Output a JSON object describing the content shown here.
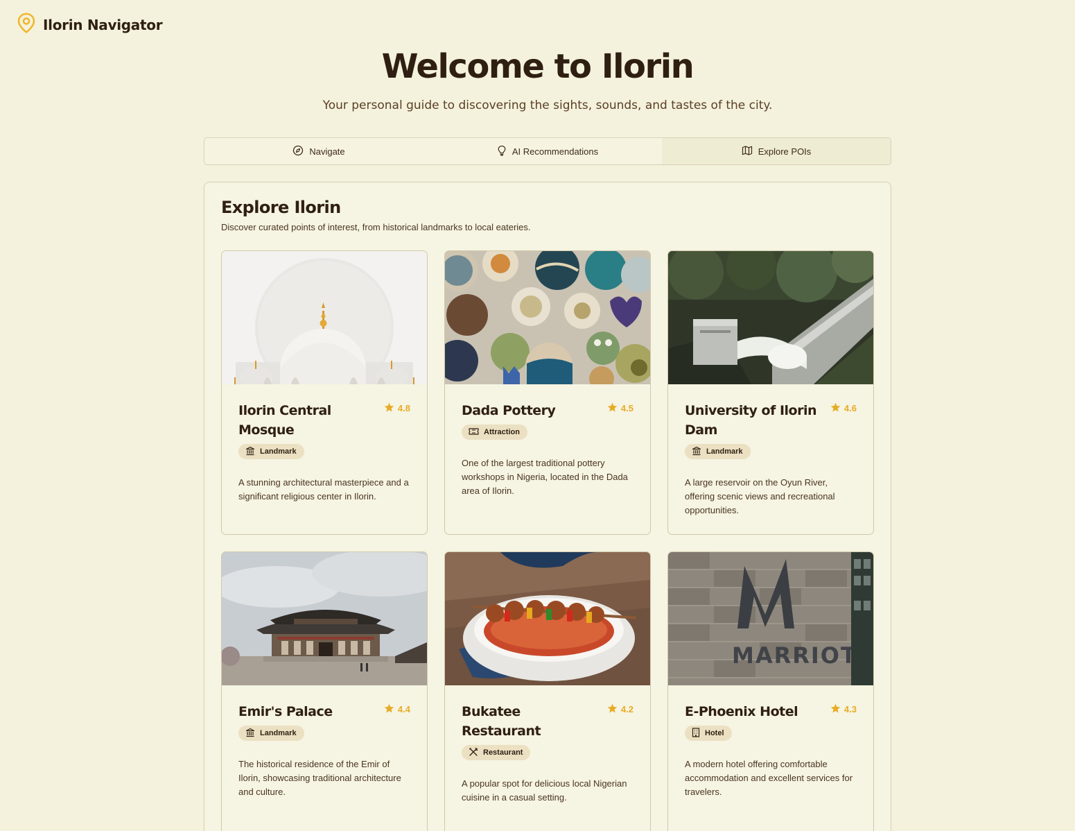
{
  "brand": {
    "title": "Ilorin Navigator",
    "icon": "map-pin-icon",
    "accent": "#f0b72f"
  },
  "hero": {
    "title": "Welcome to Ilorin",
    "subtitle": "Your personal guide to discovering the sights, sounds, and tastes of the city."
  },
  "tabs": [
    {
      "label": "Navigate",
      "icon": "compass-icon",
      "active": false
    },
    {
      "label": "AI Recommendations",
      "icon": "lightbulb-icon",
      "active": false
    },
    {
      "label": "Explore POIs",
      "icon": "map-icon",
      "active": true
    }
  ],
  "explore": {
    "title": "Explore Ilorin",
    "subtitle": "Discover curated points of interest, from historical landmarks to local eateries."
  },
  "pois": [
    {
      "name": "Ilorin Central Mosque",
      "rating": "4.8",
      "category": "Landmark",
      "category_icon": "landmark-icon",
      "description": "A stunning architectural masterpiece and a significant religious center in Ilorin.",
      "image": "mosque-photo"
    },
    {
      "name": "Dada Pottery",
      "rating": "4.5",
      "category": "Attraction",
      "category_icon": "ticket-icon",
      "description": "One of the largest traditional pottery workshops in Nigeria, located in the Dada area of Ilorin.",
      "image": "pottery-photo"
    },
    {
      "name": "University of Ilorin Dam",
      "rating": "4.6",
      "category": "Landmark",
      "category_icon": "landmark-icon",
      "description": "A large reservoir on the Oyun River, offering scenic views and recreational opportunities.",
      "image": "dam-photo"
    },
    {
      "name": "Emir's Palace",
      "rating": "4.4",
      "category": "Landmark",
      "category_icon": "landmark-icon",
      "description": "The historical residence of the Emir of Ilorin, showcasing traditional architecture and culture.",
      "image": "palace-photo"
    },
    {
      "name": "Bukatee Restaurant",
      "rating": "4.2",
      "category": "Restaurant",
      "category_icon": "utensils-icon",
      "description": "A popular spot for delicious local Nigerian cuisine in a casual setting.",
      "image": "food-photo"
    },
    {
      "name": "E-Phoenix Hotel",
      "rating": "4.3",
      "category": "Hotel",
      "category_icon": "building-icon",
      "description": "A modern hotel offering comfortable accommodation and excellent services for travelers.",
      "image": "hotel-photo",
      "image_sign_text": "MARRIOTT"
    }
  ]
}
